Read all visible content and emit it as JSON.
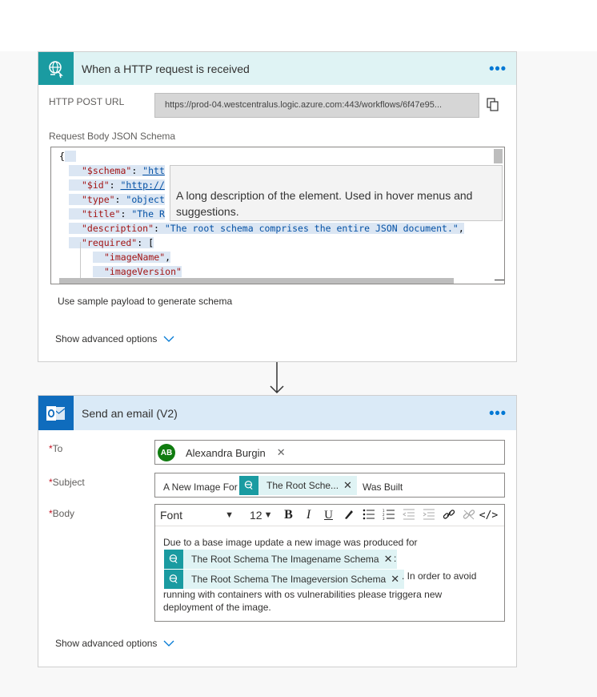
{
  "trigger": {
    "title": "When a HTTP request is received",
    "menu": "•••",
    "url_label": "HTTP POST URL",
    "url_value": "https://prod-04.westcentralus.logic.azure.com:443/workflows/6f47e95...",
    "schema_label": "Request Body JSON Schema",
    "code": {
      "l1": "{",
      "schema_key": "\"$schema\"",
      "schema_val": "\"htt",
      "id_key": "\"$id\"",
      "id_val": "\"http://",
      "type_key": "\"type\"",
      "type_val": "\"object",
      "title_key": "\"title\"",
      "title_val": "\"The R",
      "desc_key": "\"description\"",
      "desc_val": "\"The root schema comprises the entire JSON document.\"",
      "req_key": "\"required\"",
      "req_item1": "\"imageName\"",
      "req_item2": "\"imageVersion\""
    },
    "tooltip": "A long description of the element. Used in hover menus and suggestions.",
    "sample_link": "Use sample payload to generate schema",
    "advanced": "Show advanced options"
  },
  "action": {
    "title": "Send an email (V2)",
    "menu": "•••",
    "to_label": "To",
    "subject_label": "Subject",
    "body_label": "Body",
    "required_mark": "*",
    "to_chip": {
      "initials": "AB",
      "name": "Alexandra Burgin",
      "avatar_color": "#107c10"
    },
    "subject_prefix": "A New Image For",
    "subject_token": "The Root Sche...",
    "subject_suffix": "Was Built",
    "toolbar": {
      "font": "Font",
      "size": "12",
      "bold": "B",
      "italic": "I",
      "underline": "U"
    },
    "body": {
      "line1": "Due to a base image update a new image was produced for",
      "token1": "The Root Schema The Imagename Schema",
      "after_token1": ":",
      "token2": "The Root Schema The Imageversion Schema",
      "after_token2": ". In order to avoid",
      "line3": "running with containers with os vulnerabilities please triggera  new",
      "line4": "deployment of the image."
    },
    "advanced": "Show advanced options"
  },
  "colors": {
    "accent": "#0078d4",
    "trigger_icon": "#1a9ba1",
    "outlook_icon": "#0f6cbd",
    "required": "#c50f1f"
  }
}
